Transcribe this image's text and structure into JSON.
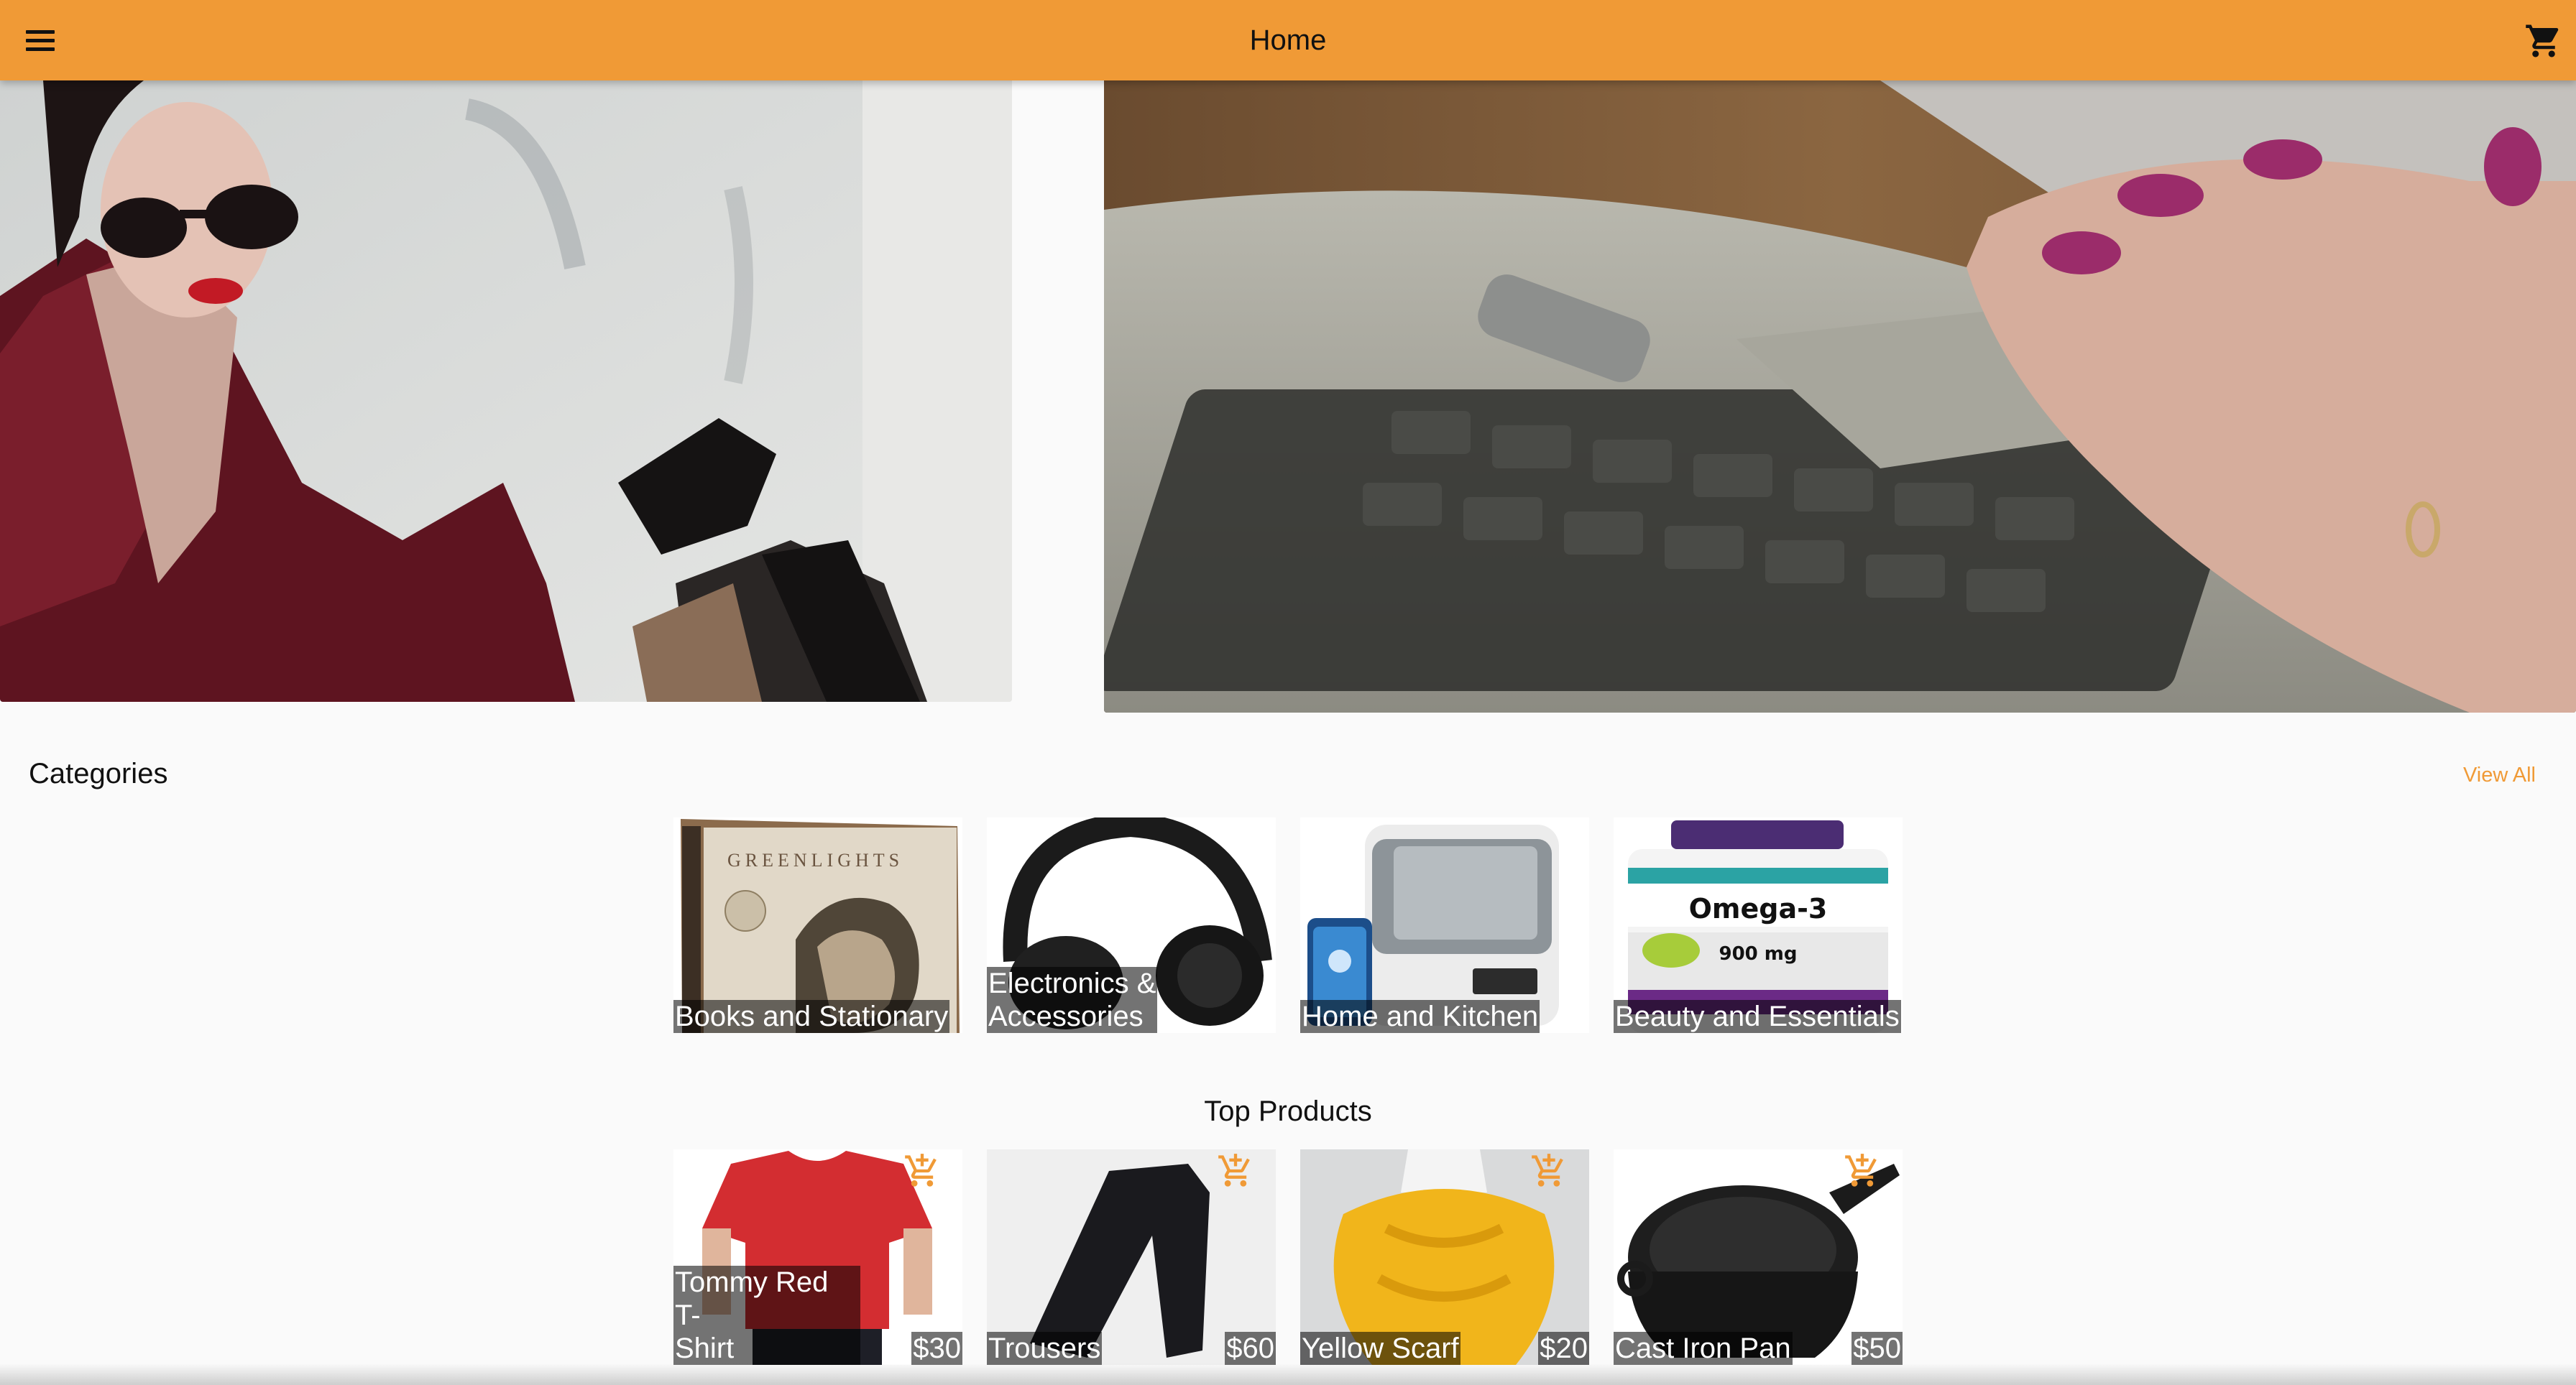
{
  "appbar": {
    "title": "Home",
    "menu_icon": "menu-icon",
    "cart_icon": "shopping-cart-icon"
  },
  "colors": {
    "primary": "#f09a36",
    "background": "#fafafa"
  },
  "categories": {
    "title": "Categories",
    "view_all": "View All",
    "items": [
      {
        "label": "Books and Stationary"
      },
      {
        "label": "Electronics &\nAccessories"
      },
      {
        "label": "Home and Kitchen"
      },
      {
        "label": "Beauty and Essentials"
      }
    ]
  },
  "top_products": {
    "title": "Top Products",
    "items": [
      {
        "name": "Tommy Red T-\nShirt",
        "price": "$30"
      },
      {
        "name": "Trousers",
        "price": "$60"
      },
      {
        "name": "Yellow Scarf",
        "price": "$20"
      },
      {
        "name": "Cast Iron Pan",
        "price": "$50"
      }
    ]
  }
}
